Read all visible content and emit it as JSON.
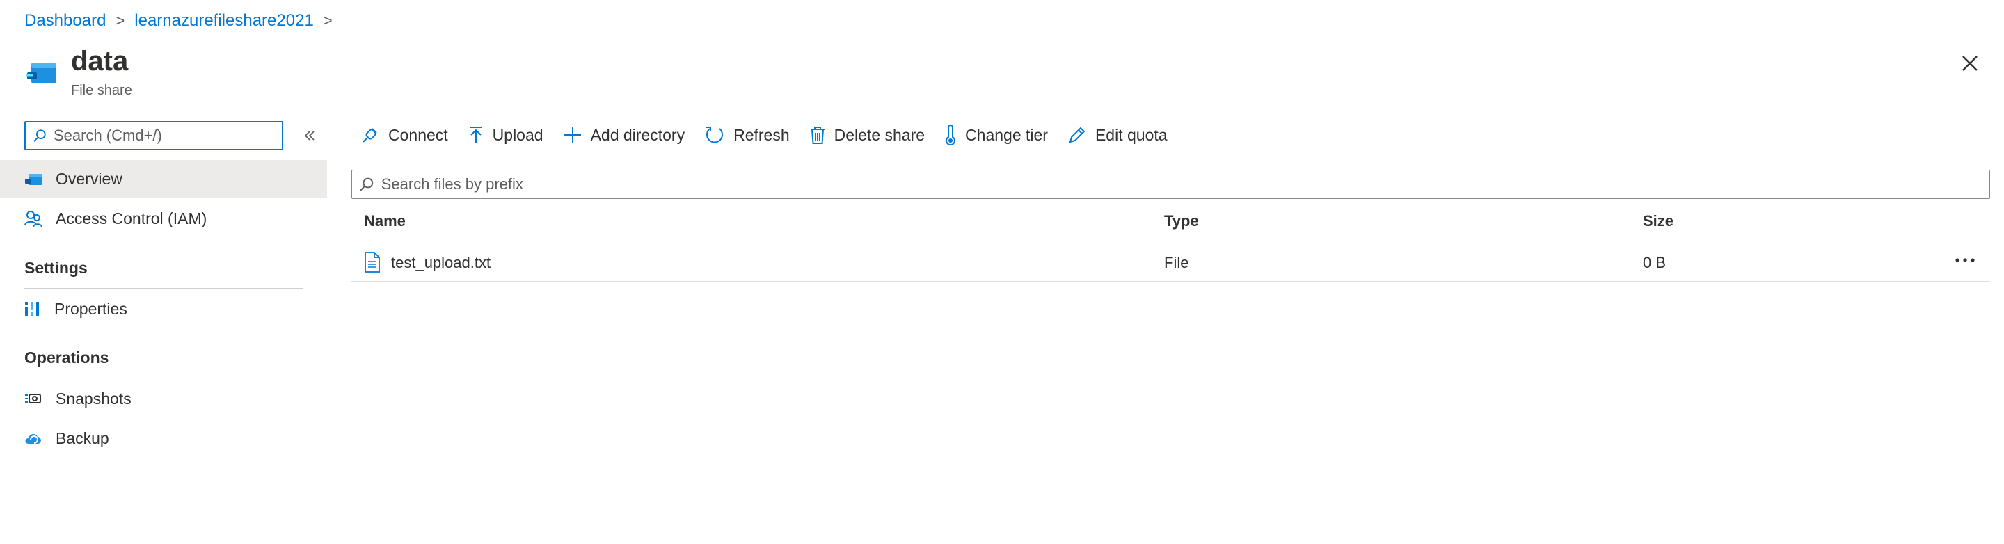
{
  "breadcrumb": {
    "items": [
      "Dashboard",
      "learnazurefileshare2021"
    ],
    "separator": ">"
  },
  "header": {
    "title": "data",
    "subtitle": "File share"
  },
  "sidebar": {
    "search_placeholder": "Search (Cmd+/)",
    "items": [
      {
        "label": "Overview",
        "active": true
      },
      {
        "label": "Access Control (IAM)"
      }
    ],
    "sections": [
      {
        "heading": "Settings",
        "items": [
          {
            "label": "Properties"
          }
        ]
      },
      {
        "heading": "Operations",
        "items": [
          {
            "label": "Snapshots"
          },
          {
            "label": "Backup"
          }
        ]
      }
    ]
  },
  "toolbar": {
    "connect": "Connect",
    "upload": "Upload",
    "add_directory": "Add directory",
    "refresh": "Refresh",
    "delete_share": "Delete share",
    "change_tier": "Change tier",
    "edit_quota": "Edit quota"
  },
  "file_list": {
    "search_placeholder": "Search files by prefix",
    "columns": [
      "Name",
      "Type",
      "Size"
    ],
    "rows": [
      {
        "name": "test_upload.txt",
        "type": "File",
        "size": "0 B"
      }
    ]
  },
  "colors": {
    "accent": "#0078d4",
    "active_bg": "#edebe9"
  }
}
